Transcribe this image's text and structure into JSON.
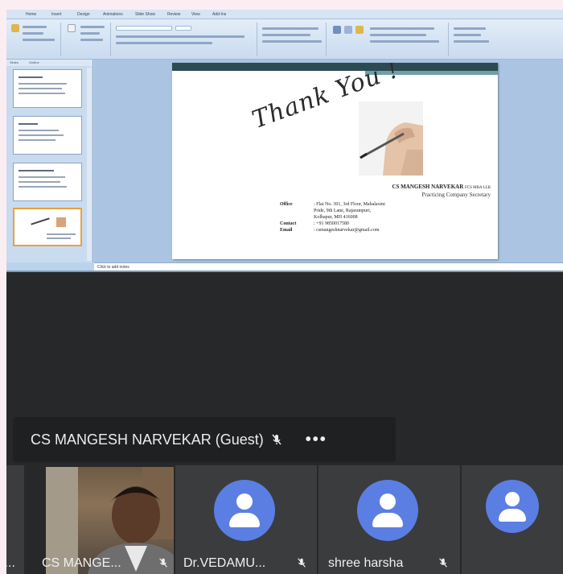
{
  "ppt": {
    "tabs": [
      "Home",
      "Insert",
      "Design",
      "Animations",
      "Slide Show",
      "Review",
      "View",
      "Add-Ins"
    ],
    "pane_tabs": [
      "Slides",
      "Outline"
    ],
    "notes_placeholder": "Click to add notes"
  },
  "slide": {
    "heading": "Thank You !",
    "name": "CS MANGESH NARVEKAR",
    "qualification": "FCS MBA LLB",
    "designation": "Practicing Company Secretary",
    "office_label": "Office",
    "office_value_1": ": Flat No. 301, 3rd Floor, Mahalaxmi",
    "office_value_2": "Pride, 9th Lane, Rajarampuri,",
    "office_value_3": "Kolhapur, MH 416008",
    "contact_label": "Contact",
    "contact_value": ": +91 9850017580",
    "email_label": "Email",
    "email_value": ": csmangeshnarvekar@gmail.com"
  },
  "meeting": {
    "speaker": "CS MANGESH NARVEKAR (Guest)",
    "more_label": "•••",
    "tiles": [
      {
        "name": "l..."
      },
      {
        "name": "CS MANGE..."
      },
      {
        "name": "Dr.VEDAMU..."
      },
      {
        "name": "shree harsha"
      },
      {
        "name": ""
      }
    ]
  },
  "colors": {
    "avatar": "#5b7ee3",
    "meeting_bg": "#262829",
    "tile_bg": "#3a3c3e"
  }
}
